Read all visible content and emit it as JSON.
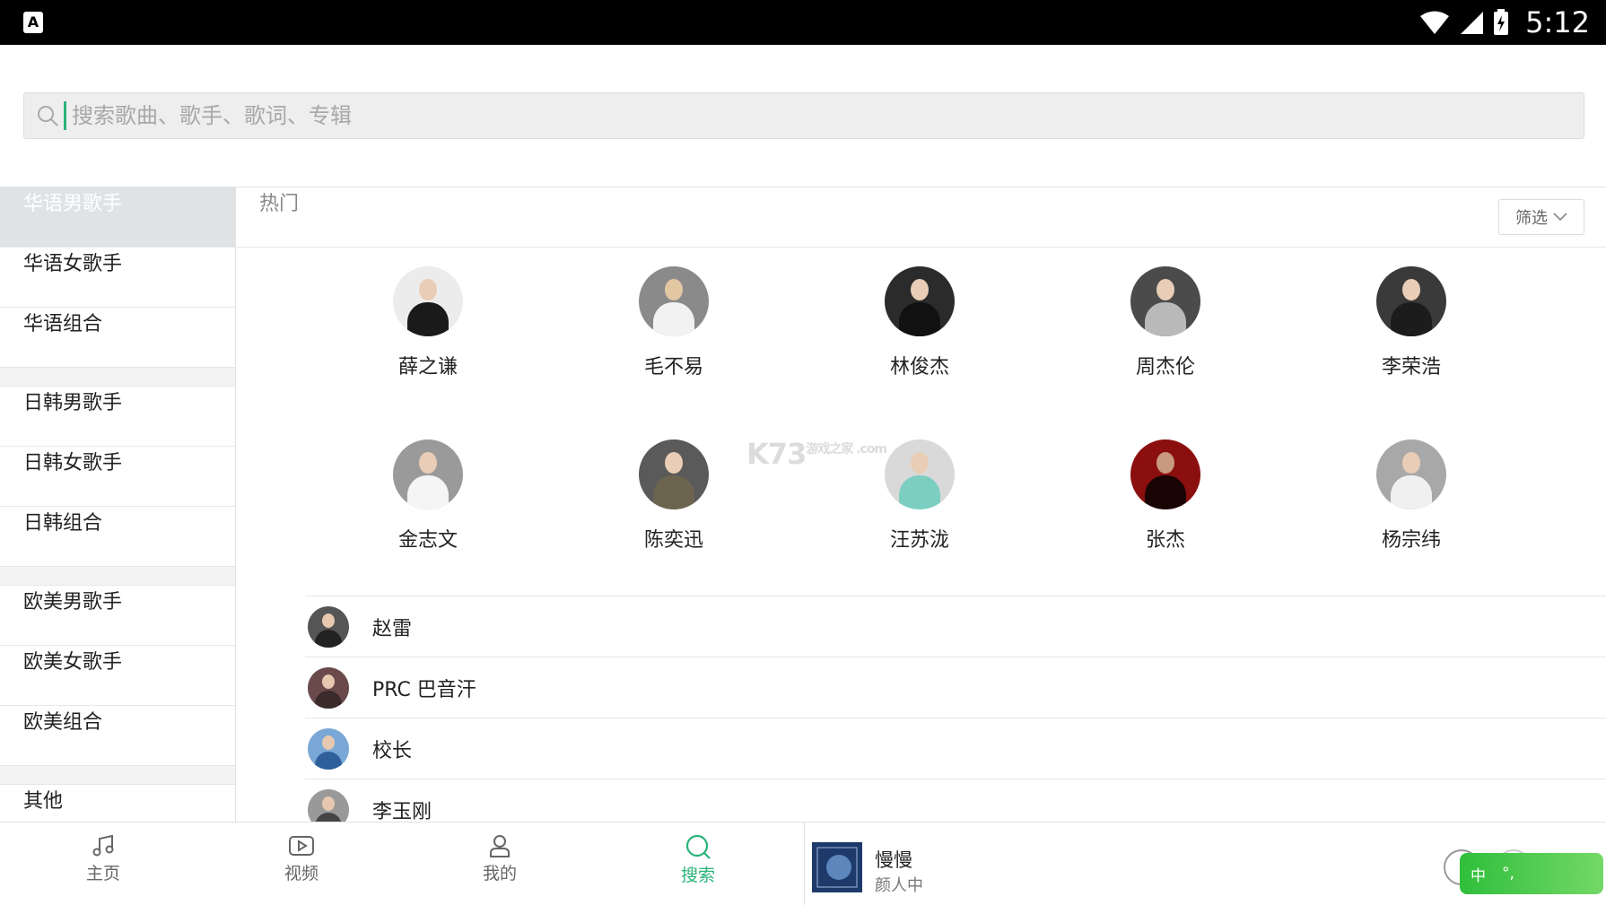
{
  "status_bar": {
    "time": "5:12",
    "left_icon": "A"
  },
  "search": {
    "placeholder": "搜索歌曲、歌手、歌词、专辑"
  },
  "sidebar": {
    "groups": [
      [
        "华语男歌手",
        "华语女歌手",
        "华语组合"
      ],
      [
        "日韩男歌手",
        "日韩女歌手",
        "日韩组合"
      ],
      [
        "欧美男歌手",
        "欧美女歌手",
        "欧美组合"
      ],
      [
        "其他"
      ]
    ],
    "active": "华语男歌手"
  },
  "main": {
    "section_label": "热门",
    "filter_label": "筛选",
    "grid_artists": [
      [
        "薛之谦",
        "毛不易",
        "林俊杰",
        "周杰伦",
        "李荣浩"
      ],
      [
        "金志文",
        "陈奕迅",
        "汪苏泷",
        "张杰",
        "杨宗纬"
      ]
    ],
    "list_artists": [
      "赵雷",
      "PRC 巴音汗",
      "校长",
      "李玉刚"
    ],
    "watermark": "K73",
    "watermark_sub": "游戏之家 .com"
  },
  "bottom_nav": {
    "items": [
      {
        "label": "主页",
        "icon": "music-note-icon"
      },
      {
        "label": "视频",
        "icon": "video-icon"
      },
      {
        "label": "我的",
        "icon": "user-icon"
      },
      {
        "label": "搜索",
        "icon": "search-icon",
        "active": true
      }
    ]
  },
  "player": {
    "song_title": "慢慢",
    "artist": "颜人中"
  },
  "ime": {
    "lang_label": "中",
    "punct_label": "°,"
  },
  "colors": {
    "accent": "#2ab37a",
    "status_bar": "#000000",
    "sidebar_active": "#dfe3e6"
  }
}
